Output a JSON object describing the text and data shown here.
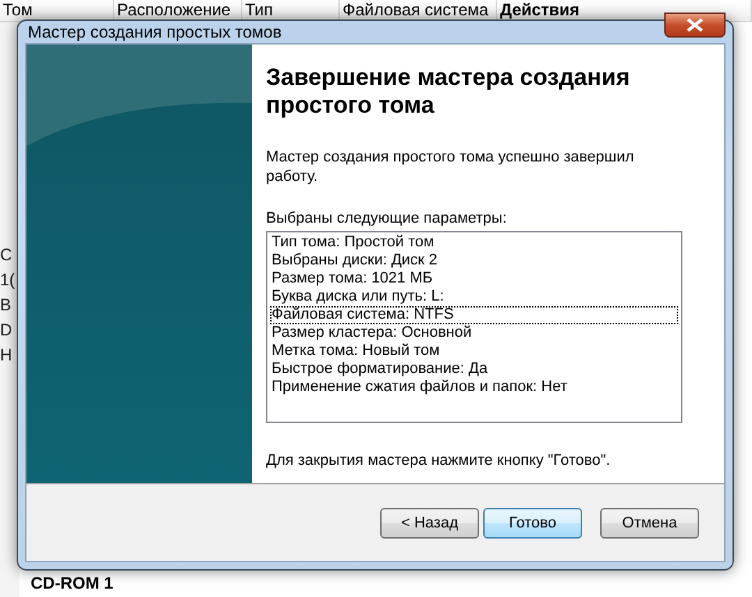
{
  "background": {
    "columns": [
      "Том",
      "Расположение",
      "Тип",
      "Файловая система",
      "Действия"
    ],
    "side_fragments": [
      "С",
      "1(",
      "В",
      "D",
      "Н"
    ],
    "device_label": "CD-ROM 1"
  },
  "window": {
    "title": "Мастер создания простых томов"
  },
  "wizard": {
    "heading": "Завершение мастера создания простого тома",
    "intro": "Мастер создания простого тома успешно завершил работу.",
    "list_label": "Выбраны следующие параметры:",
    "parameters": [
      {
        "text": "Тип тома: Простой том",
        "selected": false
      },
      {
        "text": "Выбраны диски: Диск 2",
        "selected": false
      },
      {
        "text": "Размер тома: 1021 МБ",
        "selected": false
      },
      {
        "text": "Буква диска или путь: L:",
        "selected": false
      },
      {
        "text": "Файловая система: NTFS",
        "selected": true
      },
      {
        "text": "Размер кластера: Основной",
        "selected": false
      },
      {
        "text": "Метка тома: Новый том",
        "selected": false
      },
      {
        "text": "Быстрое форматирование: Да",
        "selected": false
      },
      {
        "text": "Применение сжатия файлов и папок: Нет",
        "selected": false
      }
    ],
    "closing_note": "Для закрытия мастера нажмите кнопку \"Готово\"."
  },
  "buttons": [
    {
      "label": "< Назад",
      "default": false
    },
    {
      "label": "Готово",
      "default": true
    },
    {
      "label": "Отмена",
      "default": false
    }
  ]
}
